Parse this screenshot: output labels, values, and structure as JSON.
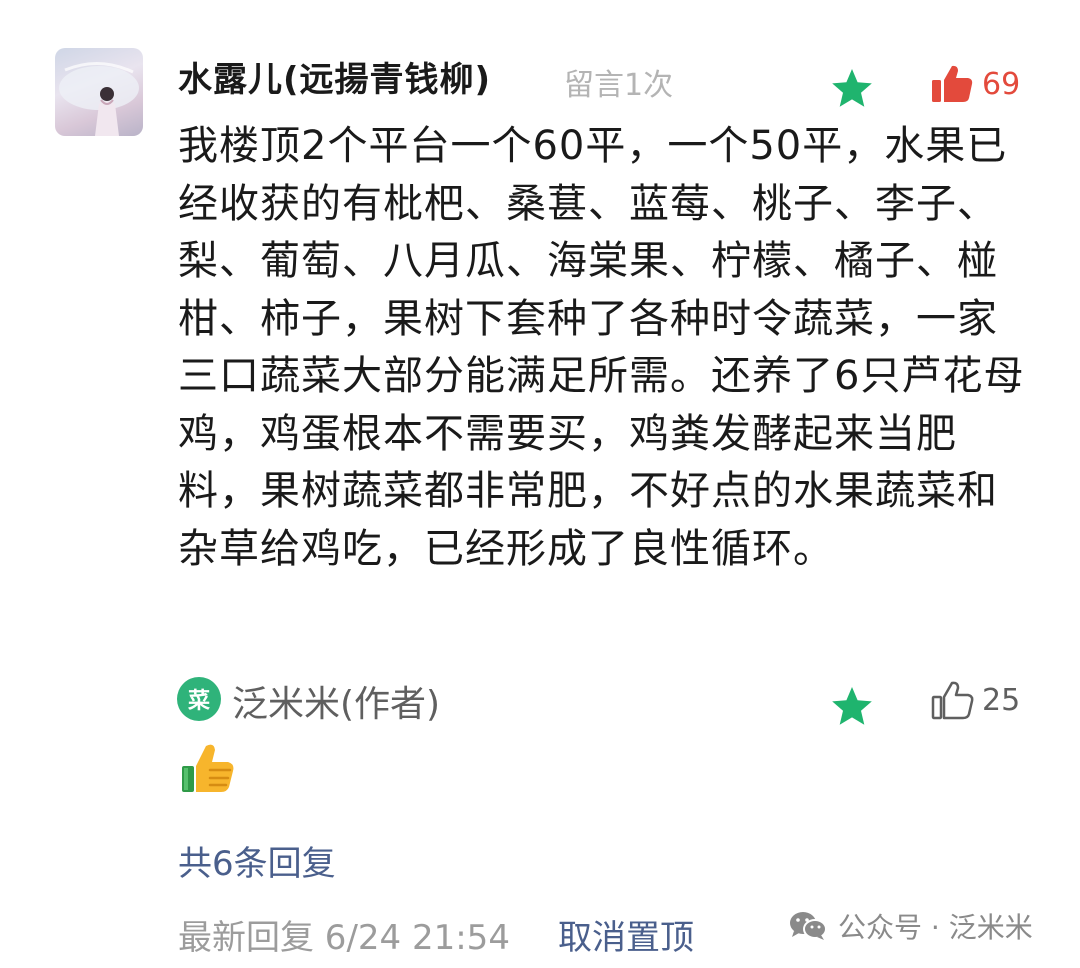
{
  "comment": {
    "nickname": "水露儿(远揚青钱柳)",
    "comment_count_note": "留言1次",
    "like_count": "69",
    "text": "我楼顶2个平台一个60平，一个50平，水果已经收获的有枇杷、桑葚、蓝莓、桃子、李子、梨、葡萄、八月瓜、海棠果、柠檬、橘子、椪柑、柿子，果树下套种了各种时令蔬菜，一家三口蔬菜大部分能满足所需。还养了6只芦花母鸡，鸡蛋根本不需要买，鸡粪发酵起来当肥料，果树蔬菜都非常肥，不好点的水果蔬菜和杂草给鸡吃，已经形成了良性循环。"
  },
  "reply": {
    "author_badge_char": "菜",
    "author_name": "泛米米(作者)",
    "like_count": "25",
    "emoji": "thumbs-up-emoji"
  },
  "footer": {
    "all_replies": "共6条回复",
    "latest_reply_time": "最新回复 6/24 21:54",
    "unpin_label": "取消置顶"
  },
  "watermark": {
    "text": "公众号 · 泛米米",
    "icon": "wechat-icon"
  },
  "colors": {
    "star": "#1fb46e",
    "like_active": "#e34a3c",
    "link_blue": "#4a5f8c",
    "author_badge": "#2fb37a"
  }
}
